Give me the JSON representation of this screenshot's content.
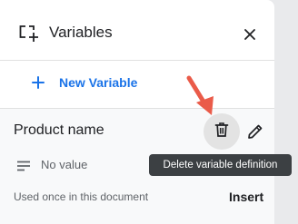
{
  "header": {
    "title": "Variables",
    "icon": "variables-icon",
    "close_icon": "close-icon"
  },
  "actions": {
    "new_variable_label": "New Variable",
    "plus_icon": "plus-icon"
  },
  "variable": {
    "name": "Product name",
    "value": "No value",
    "usage": "Used once in this document",
    "insert_label": "Insert",
    "delete_icon": "trash-icon",
    "edit_icon": "pencil-icon",
    "value_icon": "text-lines-icon"
  },
  "tooltip": {
    "text": "Delete variable definition"
  },
  "annotation": {
    "arrow_icon": "arrow-pointer-icon",
    "color": "#ea5b49"
  },
  "colors": {
    "accent": "#1a73e8",
    "tooltip_bg": "#3c4043"
  }
}
